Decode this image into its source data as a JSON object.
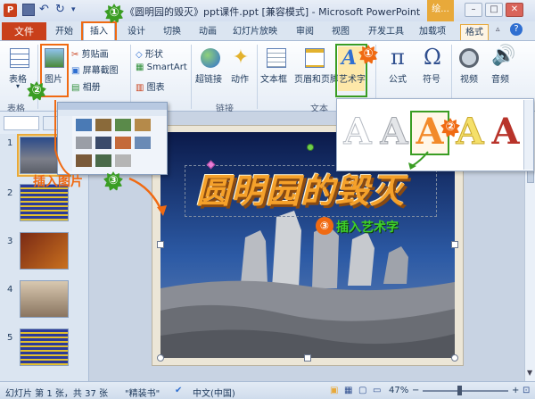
{
  "window": {
    "title": "《圆明园的毁灭》ppt课件.ppt [兼容模式] - Microsoft PowerPoint",
    "contextual_tab_group": "绘...",
    "min": "–",
    "max": "□",
    "close": "✕"
  },
  "tabs": [
    {
      "label": "文件"
    },
    {
      "label": "开始"
    },
    {
      "label": "插入"
    },
    {
      "label": "设计"
    },
    {
      "label": "切换"
    },
    {
      "label": "动画"
    },
    {
      "label": "幻灯片放映"
    },
    {
      "label": "审阅"
    },
    {
      "label": "视图"
    },
    {
      "label": "开发工具"
    },
    {
      "label": "加载项"
    },
    {
      "label": "格式"
    }
  ],
  "ribbon": {
    "table_label": "表格",
    "picture_label": "图片",
    "clipart_label": "剪贴画",
    "screenshot_label": "屏幕截图",
    "album_label": "相册",
    "shapes_label": "形状",
    "smartart_label": "SmartArt",
    "chart_label": "图表",
    "hyperlink_label": "超链接",
    "action_label": "动作",
    "textbox_label": "文本框",
    "headerfooter_label": "页眉和页脚",
    "wordart_label": "艺术字",
    "equation_label": "公式",
    "symbol_label": "符号",
    "video_label": "视频",
    "audio_label": "音频",
    "group_table": "表格",
    "group_links": "链接",
    "group_text": "文本"
  },
  "callouts": {
    "step1": "①",
    "step2": "②",
    "step3": "③",
    "insert_picture_label": "插入图片",
    "insert_wordart_label": "插入艺术字"
  },
  "slide": {
    "wordart_text": "圆明园的毁灭"
  },
  "thumbnails": [
    {
      "num": "1"
    },
    {
      "num": "2"
    },
    {
      "num": "3"
    },
    {
      "num": "4"
    },
    {
      "num": "5"
    }
  ],
  "status": {
    "slide_info": "幻灯片 第 1 张，共 37 张",
    "theme": "\"精装书\"",
    "language": "中文(中国)",
    "zoom": "47%"
  },
  "colors": {
    "accent_red": "#c9401b",
    "callout_green": "#3a9d23",
    "callout_orange": "#f06a12"
  }
}
